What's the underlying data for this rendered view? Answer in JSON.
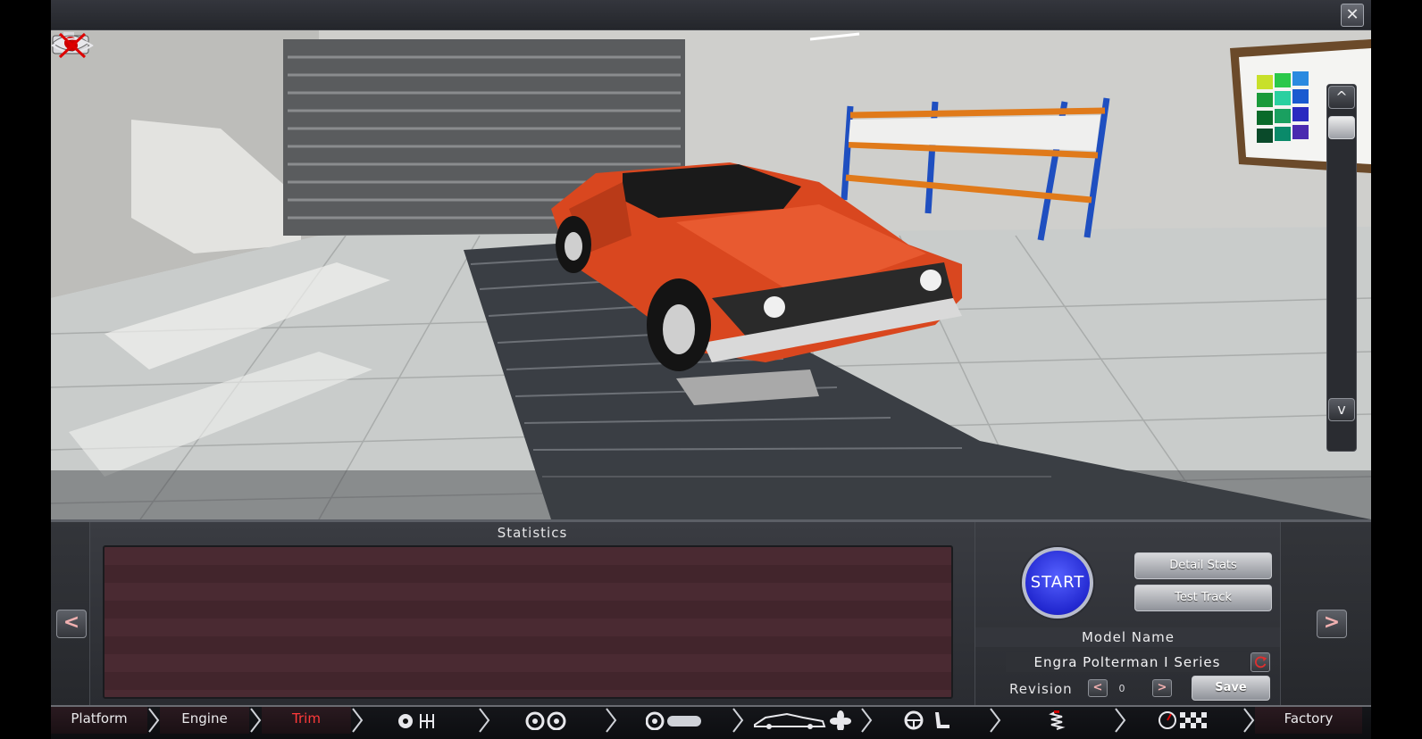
{
  "window": {
    "close_label": "✕"
  },
  "viewport": {
    "camera_up_label": "^",
    "camera_down_label": "v",
    "icons": [
      "camera-icon",
      "eye-icon",
      "hide-ui-icon"
    ]
  },
  "statistics": {
    "title": "Statistics"
  },
  "controls": {
    "start_label": "START",
    "detail_stats_label": "Detail Stats",
    "test_track_label": "Test Track",
    "model_name_label": "Model Name",
    "model_name_value": "Engra  Polterman I Series",
    "revision_label": "Revision",
    "revision_value": "0",
    "save_label": "Save",
    "prev_label": "<",
    "next_label": ">"
  },
  "nav": {
    "items": [
      "Platform",
      "Engine",
      "Trim",
      "Factory"
    ],
    "active": "Trim",
    "icon_groups": [
      "gearbox-icons",
      "wheels-icons",
      "suspension-icons",
      "body-icons",
      "interior-icons",
      "springs-icons",
      "test-icons"
    ]
  },
  "colors": {
    "accent_red": "#ff3a3a",
    "start_blue": "#2228d0",
    "car_orange": "#e0502a"
  }
}
